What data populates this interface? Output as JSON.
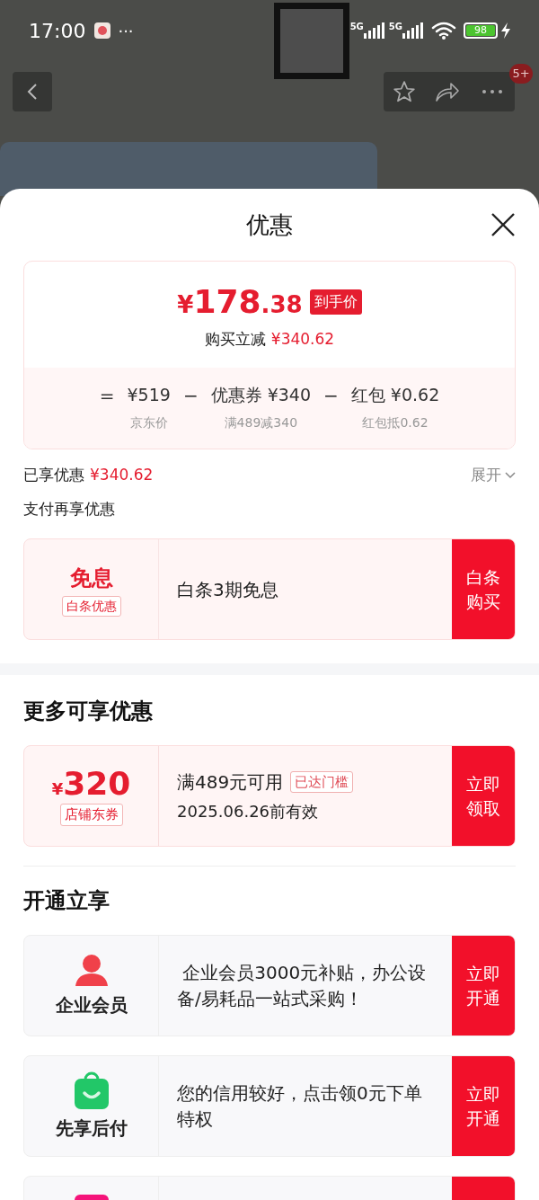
{
  "status_bar": {
    "time": "17:00",
    "more": "···",
    "network_1": "5G",
    "network_2": "5G",
    "battery": "98"
  },
  "nav": {
    "badge": "5+"
  },
  "sheet": {
    "title": "优惠"
  },
  "summary": {
    "currency": "¥",
    "price_main": "178",
    "price_fraction": ".38",
    "tag": "到手价",
    "saving_label": "购买立减",
    "saving_amount": "¥340.62",
    "breakdown": [
      {
        "operator": "=",
        "amount": "¥519",
        "note": "京东价"
      },
      {
        "operator": "−",
        "amount": "优惠券 ¥340",
        "note": "满489减340"
      },
      {
        "operator": "−",
        "amount": "红包 ¥0.62",
        "note": "红包抵0.62"
      }
    ]
  },
  "enjoyed": {
    "label": "已享优惠",
    "amount": "¥340.62",
    "expand": "展开"
  },
  "pay_section": {
    "title": "支付再享优惠",
    "card": {
      "title": "免息",
      "tag": "白条优惠",
      "text": "白条3期免息",
      "button": "白条购买"
    }
  },
  "more_section": {
    "title": "更多可享优惠",
    "coupon": {
      "currency": "¥",
      "amount": "320",
      "tag": "店铺东券",
      "condition": "满489元可用",
      "badge": "已达门槛",
      "validity": "2025.06.26前有效",
      "button": "立即领取"
    }
  },
  "open_section": {
    "title": "开通立享",
    "items": [
      {
        "kind": "person",
        "name": "企业会员",
        "text": " 企业会员3000元补贴，办公设备/易耗品一站式采购！",
        "button": "立即开通"
      },
      {
        "kind": "bag",
        "name": "先享后付",
        "text": "您的信用较好，点击领0元下单特权",
        "button": "立即开通"
      },
      {
        "kind": "square"
      }
    ]
  }
}
